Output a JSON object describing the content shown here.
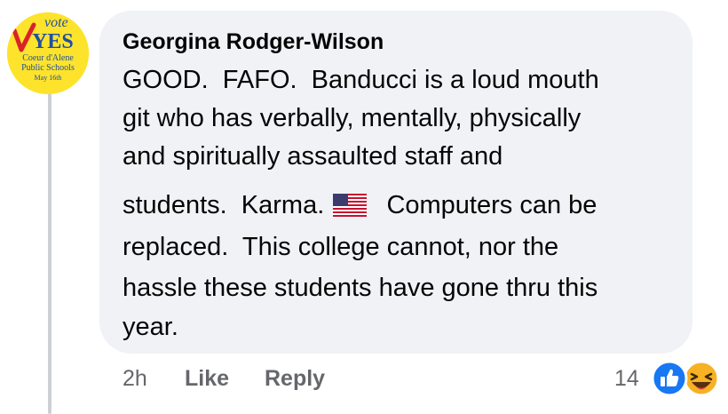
{
  "avatar": {
    "label_top": "vote",
    "label_main": "YES",
    "label_line1": "Coeur d'Alene",
    "label_line2": "Public Schools",
    "label_date": "May 16th",
    "colors": {
      "background": "#fde32b",
      "text": "#1f4fa0"
    }
  },
  "comment": {
    "author": "Georgina Rodger-Wilson",
    "lines": [
      "GOOD.  FAFO.  Banducci is a loud mouth",
      "git who has verbally, mentally, physically",
      "and spiritually assaulted staff and",
      "students.  Karma. ",
      "  Computers can be",
      "replaced.  This college cannot, nor the",
      "hassle these students have gone thru this",
      "year."
    ],
    "inline_icon": "us-flag-emoji"
  },
  "actions": {
    "time": "2h",
    "like_label": "Like",
    "reply_label": "Reply"
  },
  "reactions": {
    "count": "14",
    "icons": [
      "like-reaction-icon",
      "haha-reaction-icon"
    ],
    "colors": {
      "like": "#1877f2",
      "haha": "#f7b125"
    }
  },
  "theme": {
    "bubble": "#f0f2f5",
    "text": "#050505",
    "secondary_text": "#65676b",
    "thread_line": "#ccd0d5"
  }
}
